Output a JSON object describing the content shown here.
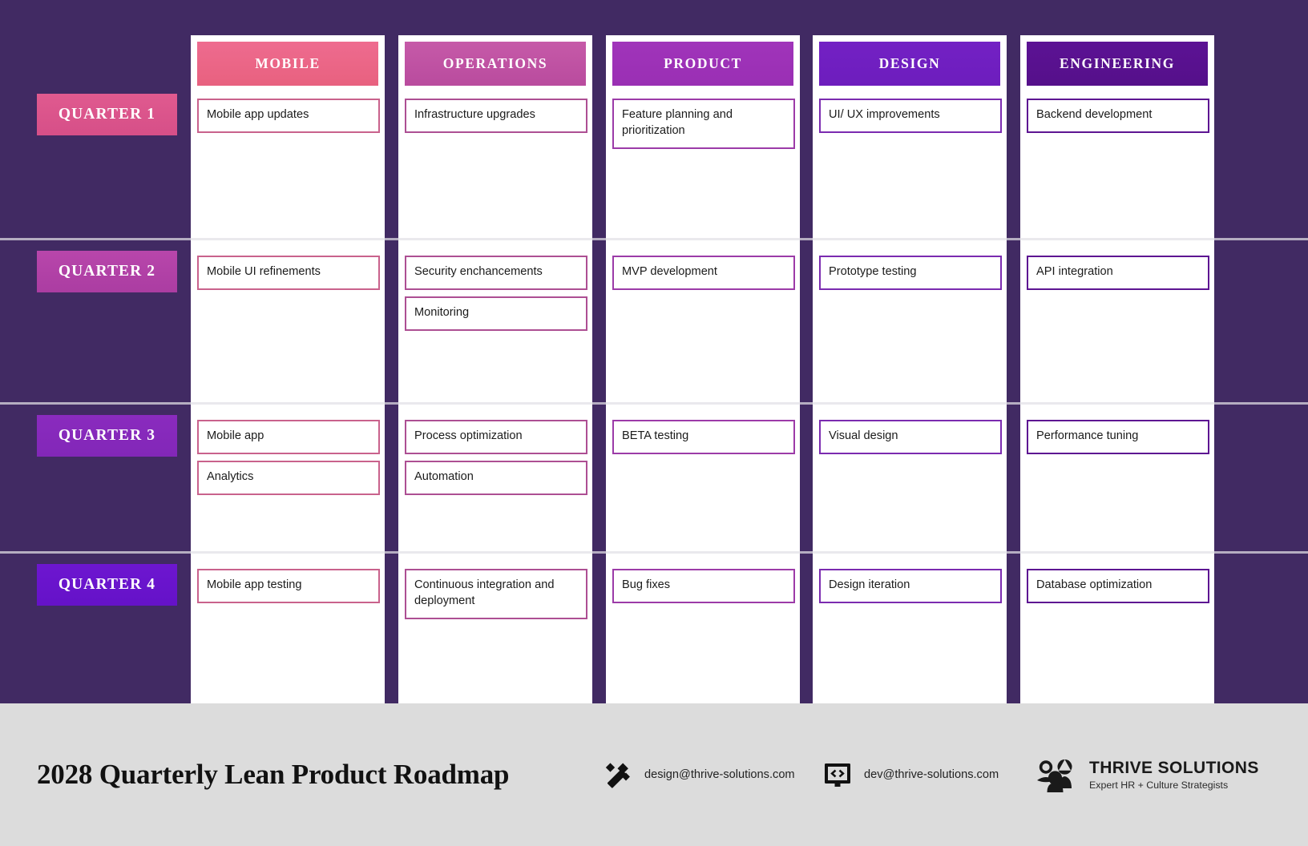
{
  "theme": {
    "background": "#412a63",
    "footer_background": "#dcdcdc",
    "card_surface": "#ffffff",
    "separator": "#e2e0e6"
  },
  "columns": [
    {
      "label": "MOBILE",
      "color_start": "#ee6b8f",
      "color_end": "#e8617f",
      "border": "#c9628c"
    },
    {
      "label": "OPERATIONS",
      "color_start": "#c65aa8",
      "color_end": "#b94b9e",
      "border": "#ad4f93"
    },
    {
      "label": "PRODUCT",
      "color_start": "#a034ba",
      "color_end": "#9a2fb4",
      "border": "#9c3ba8"
    },
    {
      "label": "DESIGN",
      "color_start": "#7321c4",
      "color_end": "#6d1dbd",
      "border": "#7b2bb0"
    },
    {
      "label": "ENGINEERING",
      "color_start": "#5c1294",
      "color_end": "#55108a",
      "border": "#5d1592"
    }
  ],
  "quarters": [
    {
      "label": "QUARTER 1",
      "color_start": "#e05a8f",
      "color_end": "#d64f88"
    },
    {
      "label": "QUARTER 2",
      "color_start": "#b846ab",
      "color_end": "#ab3da2"
    },
    {
      "label": "QUARTER 3",
      "color_start": "#8a2bbe",
      "color_end": "#8227b8"
    },
    {
      "label": "QUARTER 4",
      "color_start": "#6d16d0",
      "color_end": "#6512c8"
    }
  ],
  "cells": [
    [
      [
        "Mobile app updates"
      ],
      [
        "Infrastructure upgrades"
      ],
      [
        "Feature planning and prioritization"
      ],
      [
        "UI/ UX improvements"
      ],
      [
        "Backend development"
      ]
    ],
    [
      [
        "Mobile UI refinements"
      ],
      [
        "Security enchancements",
        "Monitoring"
      ],
      [
        "MVP development"
      ],
      [
        "Prototype testing"
      ],
      [
        "API integration"
      ]
    ],
    [
      [
        "Mobile app",
        "Analytics"
      ],
      [
        "Process optimization",
        "Automation"
      ],
      [
        "BETA testing"
      ],
      [
        "Visual design"
      ],
      [
        "Performance tuning"
      ]
    ],
    [
      [
        "Mobile app testing"
      ],
      [
        "Continuous integration and deployment"
      ],
      [
        "Bug fixes"
      ],
      [
        "Design iteration"
      ],
      [
        "Database optimization"
      ]
    ]
  ],
  "footer": {
    "title": "2028 Quarterly Lean Product Roadmap",
    "contacts": [
      {
        "icon": "magic-wand-icon",
        "email": "design@thrive-solutions.com"
      },
      {
        "icon": "code-monitor-icon",
        "email": "dev@thrive-solutions.com"
      }
    ],
    "logo": {
      "icon": "people-group-icon",
      "name": "THRIVE SOLUTIONS",
      "tagline": "Expert HR + Culture Strategists"
    }
  }
}
